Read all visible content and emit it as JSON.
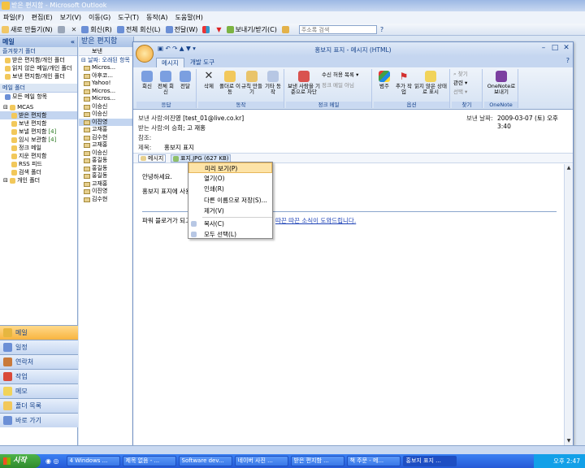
{
  "back_window": {
    "title": "받은 편지함 - Microsoft Outlook",
    "menu": [
      "파일(F)",
      "편집(E)",
      "보기(V)",
      "이동(G)",
      "도구(T)",
      "동작(A)",
      "도움말(H)"
    ],
    "toolbar": {
      "new": "새로 만들기(N)",
      "reply": "회신(R)",
      "reply_all": "전체 회신(L)",
      "forward": "전달(W)",
      "send_receive": "보내기/받기(C)",
      "address_placeholder": "주소록 검색"
    }
  },
  "nav": {
    "header": "메일",
    "favorites_header": "즐겨찾기 폴더",
    "favorites": [
      "받은 편지함/개인 폴더",
      "읽지 않은 메일/개인 폴더",
      "보낸 편지함/개인 폴더"
    ],
    "mail_folders_header": "메일 폴더",
    "all_mail_items": "모든 메일 항목",
    "tree": [
      {
        "label": "MCAS",
        "count": "",
        "level": 0,
        "selected": false
      },
      {
        "label": "받은 편지함",
        "count": "",
        "level": 1,
        "selected": true
      },
      {
        "label": "보낸 편지함",
        "count": "",
        "level": 1,
        "selected": false
      },
      {
        "label": "보낼 편지함",
        "count": "[4]",
        "level": 1,
        "selected": false
      },
      {
        "label": "임시 보관함",
        "count": "[4]",
        "level": 1,
        "selected": false
      },
      {
        "label": "정크 메일",
        "count": "",
        "level": 1,
        "selected": false
      },
      {
        "label": "지운 편지함",
        "count": "",
        "level": 1,
        "selected": false
      },
      {
        "label": "RSS 피드",
        "count": "",
        "level": 1,
        "selected": false
      },
      {
        "label": "검색 폴더",
        "count": "",
        "level": 1,
        "selected": false
      },
      {
        "label": "개인 폴더",
        "count": "",
        "level": 0,
        "selected": false
      }
    ],
    "buttons": [
      "메일",
      "일정",
      "연락처",
      "작업",
      "메모",
      "폴더 목록",
      "바로 가기"
    ]
  },
  "list": {
    "header": "받은 편지함",
    "columns": [
      "보낸"
    ],
    "group": "날짜: 오래된 항목",
    "senders": [
      "Micros...",
      "야후코...",
      "Yahoo!",
      "Micros...",
      "Micros...",
      "이승신",
      "이승신",
      "이진영",
      "고재홍",
      "김수현",
      "고재홍",
      "이승신",
      "홍길동",
      "홍길동",
      "홍길동",
      "고재홍",
      "이진영",
      "김수현"
    ]
  },
  "message": {
    "title": "홍보지 표지 - 메시지 (HTML)",
    "tabs": [
      "메시지",
      "개발 도구"
    ],
    "ribbon": {
      "groups": [
        {
          "label": "응답",
          "buttons": [
            "회신",
            "전체 회신",
            "전달"
          ]
        },
        {
          "label": "동작",
          "buttons": [
            "삭제",
            "폴더로 이동",
            "규칙 만들기",
            "기타 동작"
          ]
        },
        {
          "label": "정크 메일",
          "buttons": [
            "보낸 사람을 기준으로 차단",
            "수신 허용 목록",
            "정크 메일 아님"
          ]
        },
        {
          "label": "옵션",
          "buttons": [
            "범주",
            "추가 작업",
            "읽지 않은 상태로 표시"
          ]
        },
        {
          "label": "찾기",
          "buttons": [
            "찾기",
            "관련",
            "선택"
          ]
        },
        {
          "label": "OneNote",
          "buttons": [
            "OneNote로 보내기"
          ]
        }
      ]
    },
    "from_label": "보낸 사람:",
    "from_value": "이진영 [test_01@live.co.kr]",
    "sent_label": "보낸 날짜:",
    "sent_value": "2009-03-07 (토) 오후 3:40",
    "to_label": "받는 사람:",
    "to_value": "이 승희; 고 재홍",
    "cc_label": "참조:",
    "cc_value": "",
    "subject_label": "제목:",
    "subject_value": "홍보지 표지",
    "attachments": [
      "메시지",
      "표지.JPG (627 KB)"
    ],
    "body": {
      "line1": "안녕하세요.",
      "line2": "홍보지 표지에 사용",
      "line3_prefix": "파워 블로거가 되고",
      "line3_link": "따끈 따끈 소식이 도와드립니다."
    }
  },
  "context_menu": {
    "items": [
      "미리 보기(P)",
      "열기(O)",
      "인쇄(R)",
      "다른 이름으로 저장(S)...",
      "제거(V)",
      "복사(C)",
      "모두 선택(L)"
    ],
    "highlighted": 0
  },
  "taskbar": {
    "start": "시작",
    "tasks": [
      "4 Windows ...",
      "제목 없음 - ...",
      "Software dev...",
      "네이버 사진 ...",
      "받은 편지함 ...",
      "책 주문 - 메...",
      "홍보지 표지 ..."
    ],
    "active_task": 6,
    "clock": "오후 2:47"
  }
}
